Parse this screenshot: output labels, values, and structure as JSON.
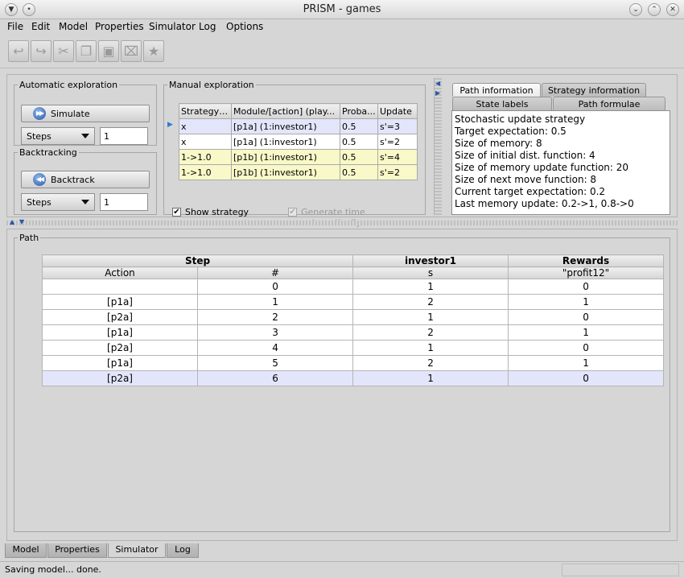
{
  "window": {
    "title": "PRISM - games"
  },
  "menu": [
    "File",
    "Edit",
    "Model",
    "Properties",
    "Simulator",
    "Log",
    "Options"
  ],
  "toolbar": {
    "icons": [
      "undo-icon",
      "redo-icon",
      "scissors-icon",
      "copy-icon",
      "paste-icon",
      "delete-icon",
      "star-icon"
    ]
  },
  "auto_explore": {
    "legend": "Automatic exploration",
    "simulate_label": "Simulate",
    "steps_label": "Steps",
    "steps_value": "1"
  },
  "backtracking": {
    "legend": "Backtracking",
    "backtrack_label": "Backtrack",
    "steps_label": "Steps",
    "steps_value": "1"
  },
  "manual": {
    "legend": "Manual exploration",
    "headers": [
      "Strategy ...",
      "Module/[action] (play...",
      "Proba...",
      "Update"
    ],
    "rows": [
      [
        "x",
        "[p1a] (1:investor1)",
        "0.5",
        "s'=3"
      ],
      [
        "x",
        "[p1a] (1:investor1)",
        "0.5",
        "s'=2"
      ],
      [
        "1->1.0",
        "[p1b] (1:investor1)",
        "0.5",
        "s'=4"
      ],
      [
        "1->1.0",
        "[p1b] (1:investor1)",
        "0.5",
        "s'=2"
      ]
    ],
    "show_strategy": "Show strategy",
    "generate_time": "Generate time automatically"
  },
  "info_tabs": {
    "path_information": "Path information",
    "strategy_information": "Strategy information",
    "state_labels": "State labels",
    "path_formulae": "Path formulae",
    "lines": [
      "Stochastic update strategy",
      "Target expectation: 0.5",
      "Size of memory: 8",
      "Size of initial dist. function: 4",
      "Size of memory update function: 20",
      "Size of next move function: 8",
      "Current target expectation: 0.2",
      "Last memory update: 0.2->1, 0.8->0"
    ]
  },
  "path": {
    "legend": "Path",
    "group_headers": [
      "Step",
      "investor1",
      "Rewards"
    ],
    "sub_headers": [
      "Action",
      "#",
      "s",
      "\"profit12\""
    ],
    "rows": [
      [
        "",
        "0",
        "1",
        "0"
      ],
      [
        "[p1a]",
        "1",
        "2",
        "1"
      ],
      [
        "[p2a]",
        "2",
        "1",
        "0"
      ],
      [
        "[p1a]",
        "3",
        "2",
        "1"
      ],
      [
        "[p2a]",
        "4",
        "1",
        "0"
      ],
      [
        "[p1a]",
        "5",
        "2",
        "1"
      ],
      [
        "[p2a]",
        "6",
        "1",
        "0"
      ]
    ]
  },
  "bottom_tabs": [
    "Model",
    "Properties",
    "Simulator",
    "Log"
  ],
  "status": "Saving model... done."
}
